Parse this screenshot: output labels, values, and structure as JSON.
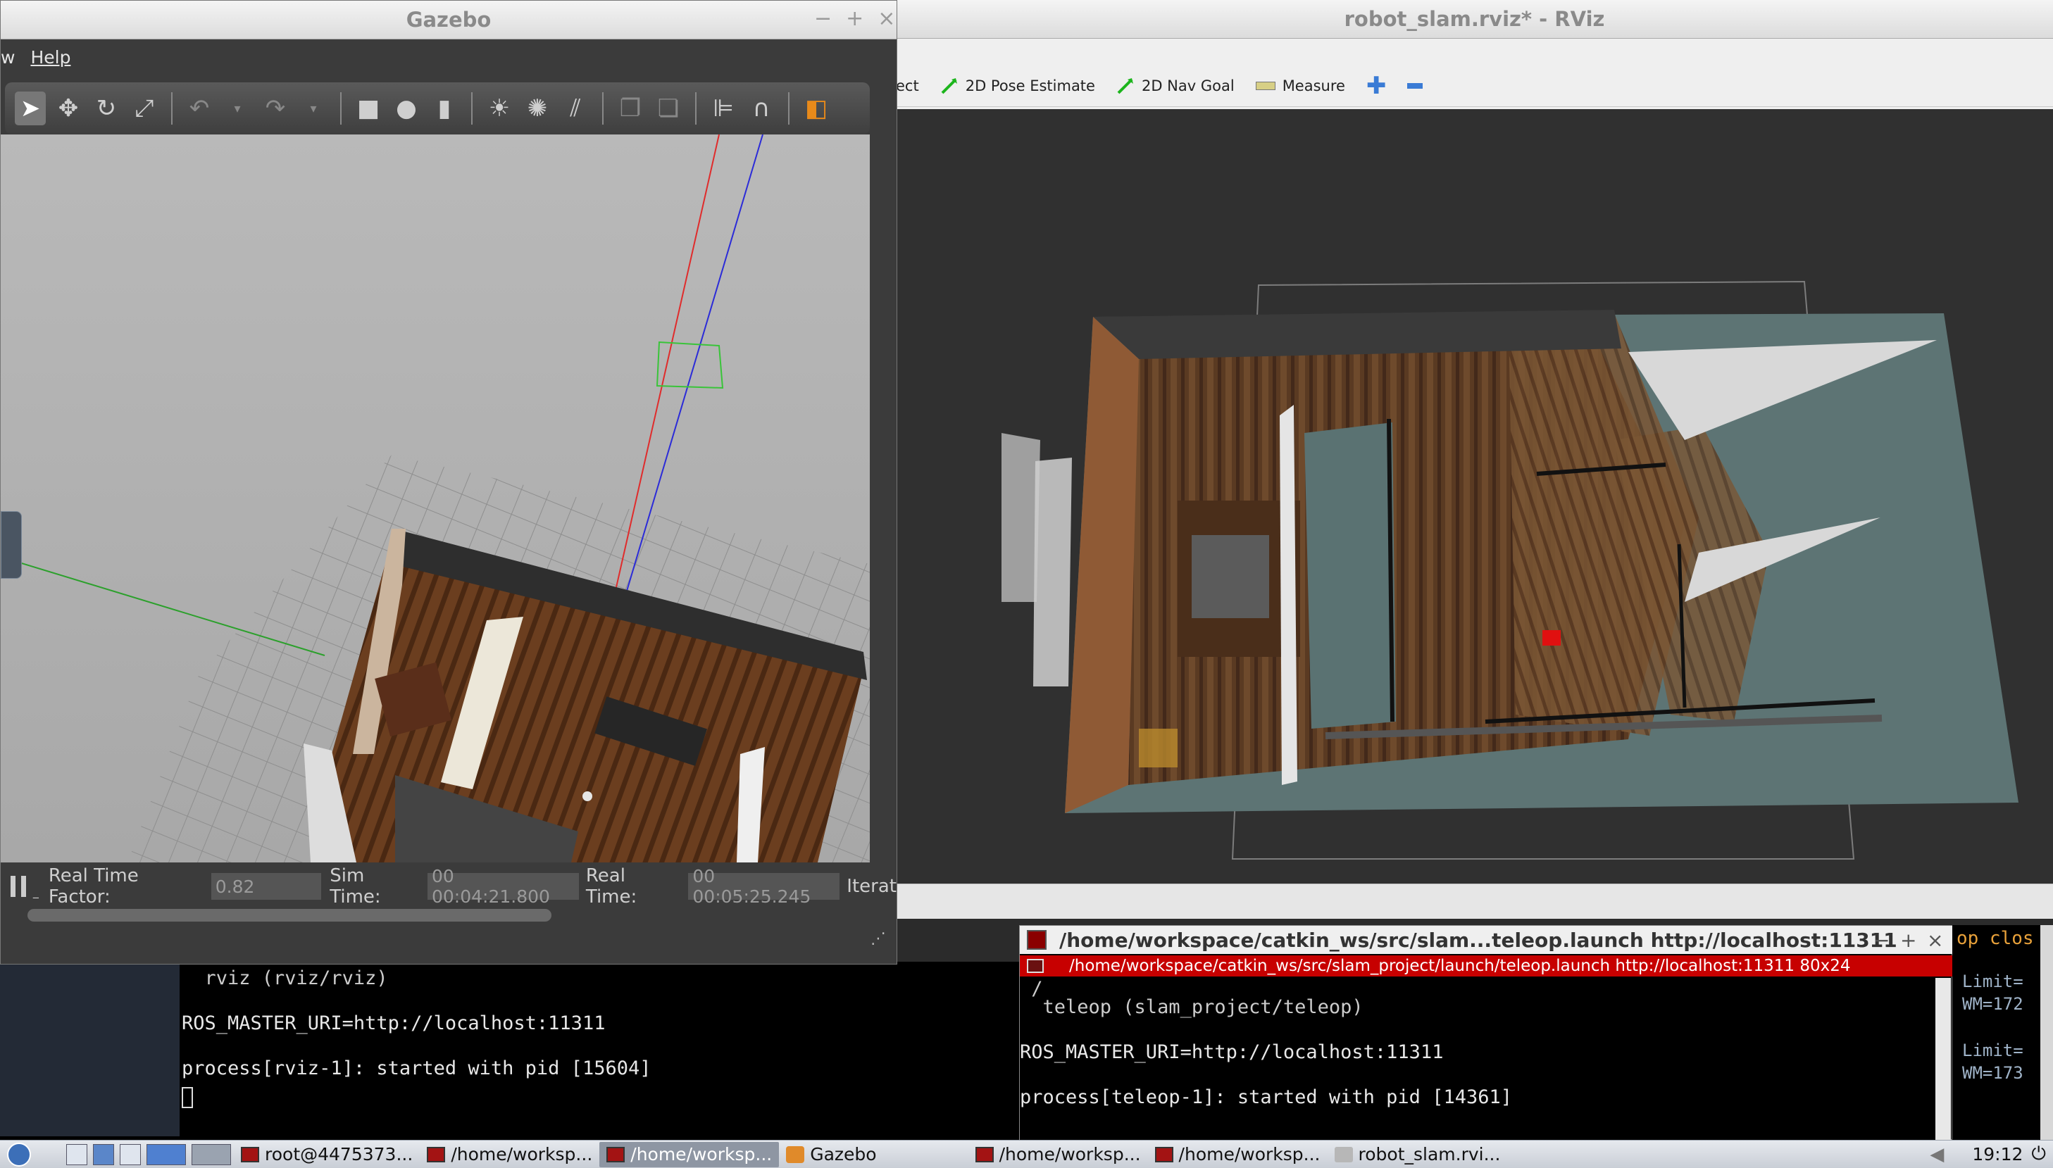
{
  "gazebo": {
    "title": "Gazebo",
    "menu": {
      "view_partial": "w",
      "help": "Help"
    },
    "toolbar_icons": [
      "select-icon",
      "translate-icon",
      "rotate-icon",
      "scale-icon",
      "undo-icon",
      "undo-dropdown-icon",
      "redo-icon",
      "redo-dropdown-icon",
      "box-icon",
      "sphere-icon",
      "cylinder-icon",
      "point-light-icon",
      "spot-light-icon",
      "directional-light-icon",
      "copy-icon",
      "paste-icon",
      "align-icon",
      "snap-icon",
      "change-view-icon"
    ],
    "bottom": {
      "rtf_label": "Real Time Factor:",
      "rtf_value": "0.82",
      "sim_label": "Sim Time:",
      "sim_value": "00 00:04:21.800",
      "real_label": "Real Time:",
      "real_value": "00 00:05:25.245",
      "iter_label": "Iterat"
    }
  },
  "rviz": {
    "title": "robot_slam.rviz* - RViz",
    "tools": [
      {
        "label": "ect",
        "icon": "interact-icon"
      },
      {
        "label": "2D Pose Estimate",
        "icon": "pose-estimate-icon"
      },
      {
        "label": "2D Nav Goal",
        "icon": "nav-goal-icon"
      },
      {
        "label": "Measure",
        "icon": "measure-icon"
      }
    ]
  },
  "term_left": {
    "l1": "  rviz (rviz/rviz)",
    "l2": "ROS_MASTER_URI=http://localhost:11311",
    "l3": "process[rviz-1]: started with pid [15604]"
  },
  "teleop": {
    "title": "/home/workspace/catkin_ws/src/slam...teleop.launch http://localhost:11311",
    "tab": "/home/workspace/catkin_ws/src/slam_project/launch/teleop.launch http://localhost:11311 80x24",
    "l1": " /",
    "l2": "  teleop (slam_project/teleop)",
    "l3": "ROS_MASTER_URI=http://localhost:11311",
    "l4": "process[teleop-1]: started with pid [14361]"
  },
  "term_right": {
    "top": "op clos",
    "a1": "Limit=",
    "a2": "WM=172",
    "b1": "Limit=",
    "b2": "WM=173"
  },
  "taskbar": {
    "tasks": [
      "root@4475373...",
      "/home/worksp...",
      "/home/worksp...",
      "Gazebo",
      "/home/worksp...",
      "/home/worksp...",
      "robot_slam.rvi..."
    ],
    "clock": "19:12"
  }
}
